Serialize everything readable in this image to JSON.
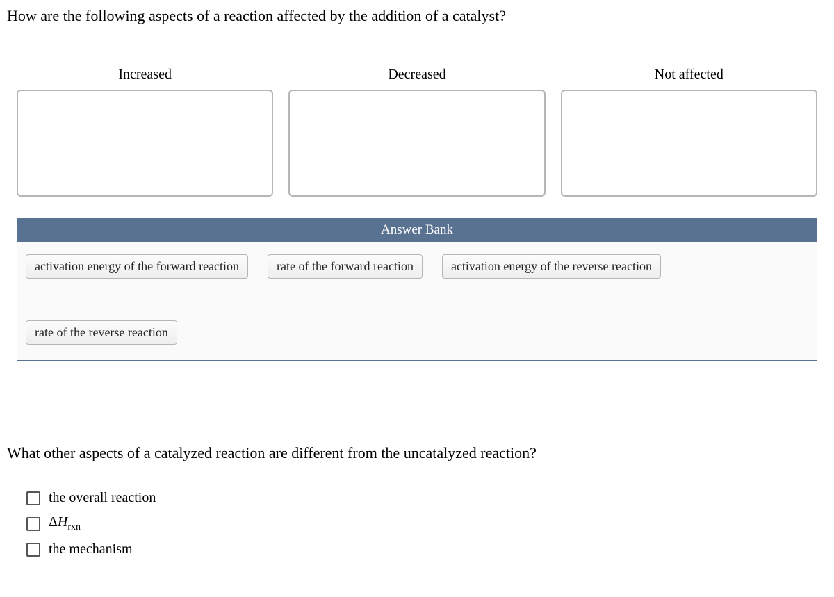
{
  "question1": "How are the following aspects of a reaction affected by the addition of a catalyst?",
  "categories": {
    "increased": "Increased",
    "decreased": "Decreased",
    "not_affected": "Not affected"
  },
  "answer_bank": {
    "title": "Answer Bank",
    "items": [
      "activation energy of the forward reaction",
      "rate of the forward reaction",
      "activation energy of the reverse reaction",
      "rate of the reverse reaction"
    ]
  },
  "question2": "What other aspects of a catalyzed reaction are different from the uncatalyzed reaction?",
  "options": {
    "opt1": "the overall reaction",
    "opt2_delta": "Δ",
    "opt2_H": "H",
    "opt2_sub": "rxn",
    "opt3": "the mechanism"
  }
}
